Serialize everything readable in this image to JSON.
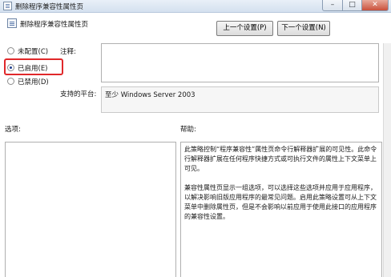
{
  "window": {
    "title": "删除程序兼容性属性页",
    "controls": {
      "minimize": "–",
      "maximize": "□",
      "close": "✕"
    }
  },
  "header": {
    "title": "删除程序兼容性属性页",
    "icon": "policy-icon"
  },
  "nav": {
    "prev_label": "上一个设置(P)",
    "next_label": "下一个设置(N)"
  },
  "state_options": [
    {
      "label": "未配置(C)",
      "checked": false
    },
    {
      "label": "已启用(E)",
      "checked": true
    },
    {
      "label": "已禁用(D)",
      "checked": false
    }
  ],
  "comment": {
    "label": "注释:",
    "value": ""
  },
  "platform": {
    "label": "支持的平台:",
    "value": "至少 Windows Server 2003"
  },
  "options": {
    "label": "选项:"
  },
  "help": {
    "label": "帮助:",
    "paragraphs": [
      "此策略控制“程序兼容性”属性页命令行解释器扩展的可见性。此命令行解释器扩展在任何程序快捷方式或可执行文件的属性上下文菜单上可见。",
      "兼容性属性页显示一组选项，可以选择这些选项并应用于应用程序，以解决影响旧版应用程序的最常见问题。启用此策略设置可从上下文菜单中删除属性页，但是不会影响以前应用于使用此接口的应用程序的兼容性设置。"
    ]
  },
  "colors": {
    "highlight_border": "#e0282a",
    "titlebar": "#d4e1ef",
    "close_button": "#c9503b"
  }
}
